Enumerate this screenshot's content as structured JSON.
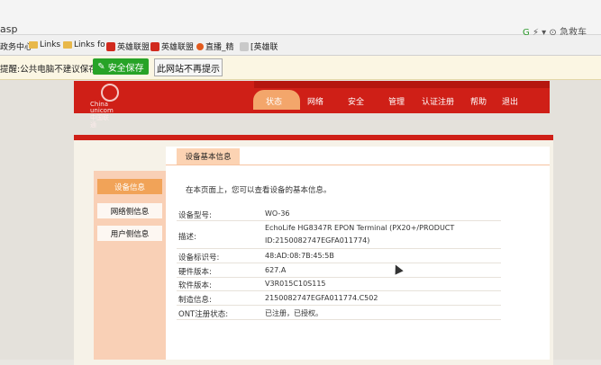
{
  "browser": {
    "url_fragment": "asp",
    "search_text": "急救车"
  },
  "bookmarks": [
    {
      "label": "政务中心",
      "icon": "none"
    },
    {
      "label": "Links",
      "icon": "folder-icon"
    },
    {
      "label": "Links fo",
      "icon": "folder-icon"
    },
    {
      "label": "英雄联盟",
      "icon": "game-icon"
    },
    {
      "label": "英雄联盟",
      "icon": "game-icon"
    },
    {
      "label": "直播_精",
      "icon": "live-icon"
    },
    {
      "label": "[英雄联",
      "icon": "doc-icon"
    }
  ],
  "password_bar": {
    "message": "提醒:公共电脑不建议保存",
    "save_button": "安全保存",
    "never_button": "此网站不再提示"
  },
  "router": {
    "brand_en_1": "China",
    "brand_en_2": "unicom中国联通",
    "nav": [
      "状态",
      "网络",
      "安全",
      "管理",
      "认证注册",
      "帮助",
      "退出"
    ],
    "active_nav": "状态",
    "sidebar": [
      "设备信息",
      "网络侧信息",
      "用户侧信息"
    ],
    "section_title": "设备基本信息",
    "intro": "在本页面上，您可以查看设备的基本信息。",
    "rows": [
      {
        "label": "设备型号:",
        "value": "WO-36"
      },
      {
        "label": "描述:",
        "value": "EchoLife HG8347R EPON Terminal (PX20+/PRODUCT",
        "value2": "ID:2150082747EGFA011774)"
      },
      {
        "label": "设备标识号:",
        "value": "48:AD:08:7B:45:5B"
      },
      {
        "label": "硬件版本:",
        "value": "627.A"
      },
      {
        "label": "软件版本:",
        "value": "V3R015C10S115"
      },
      {
        "label": "制造信息:",
        "value": "2150082747EGFA011774.C502"
      },
      {
        "label": "ONT注册状态:",
        "value": "已注册，已授权。"
      }
    ]
  },
  "colors": {
    "brand_red": "#cf1f17",
    "accent_orange": "#f1a358",
    "save_green": "#27a327"
  }
}
